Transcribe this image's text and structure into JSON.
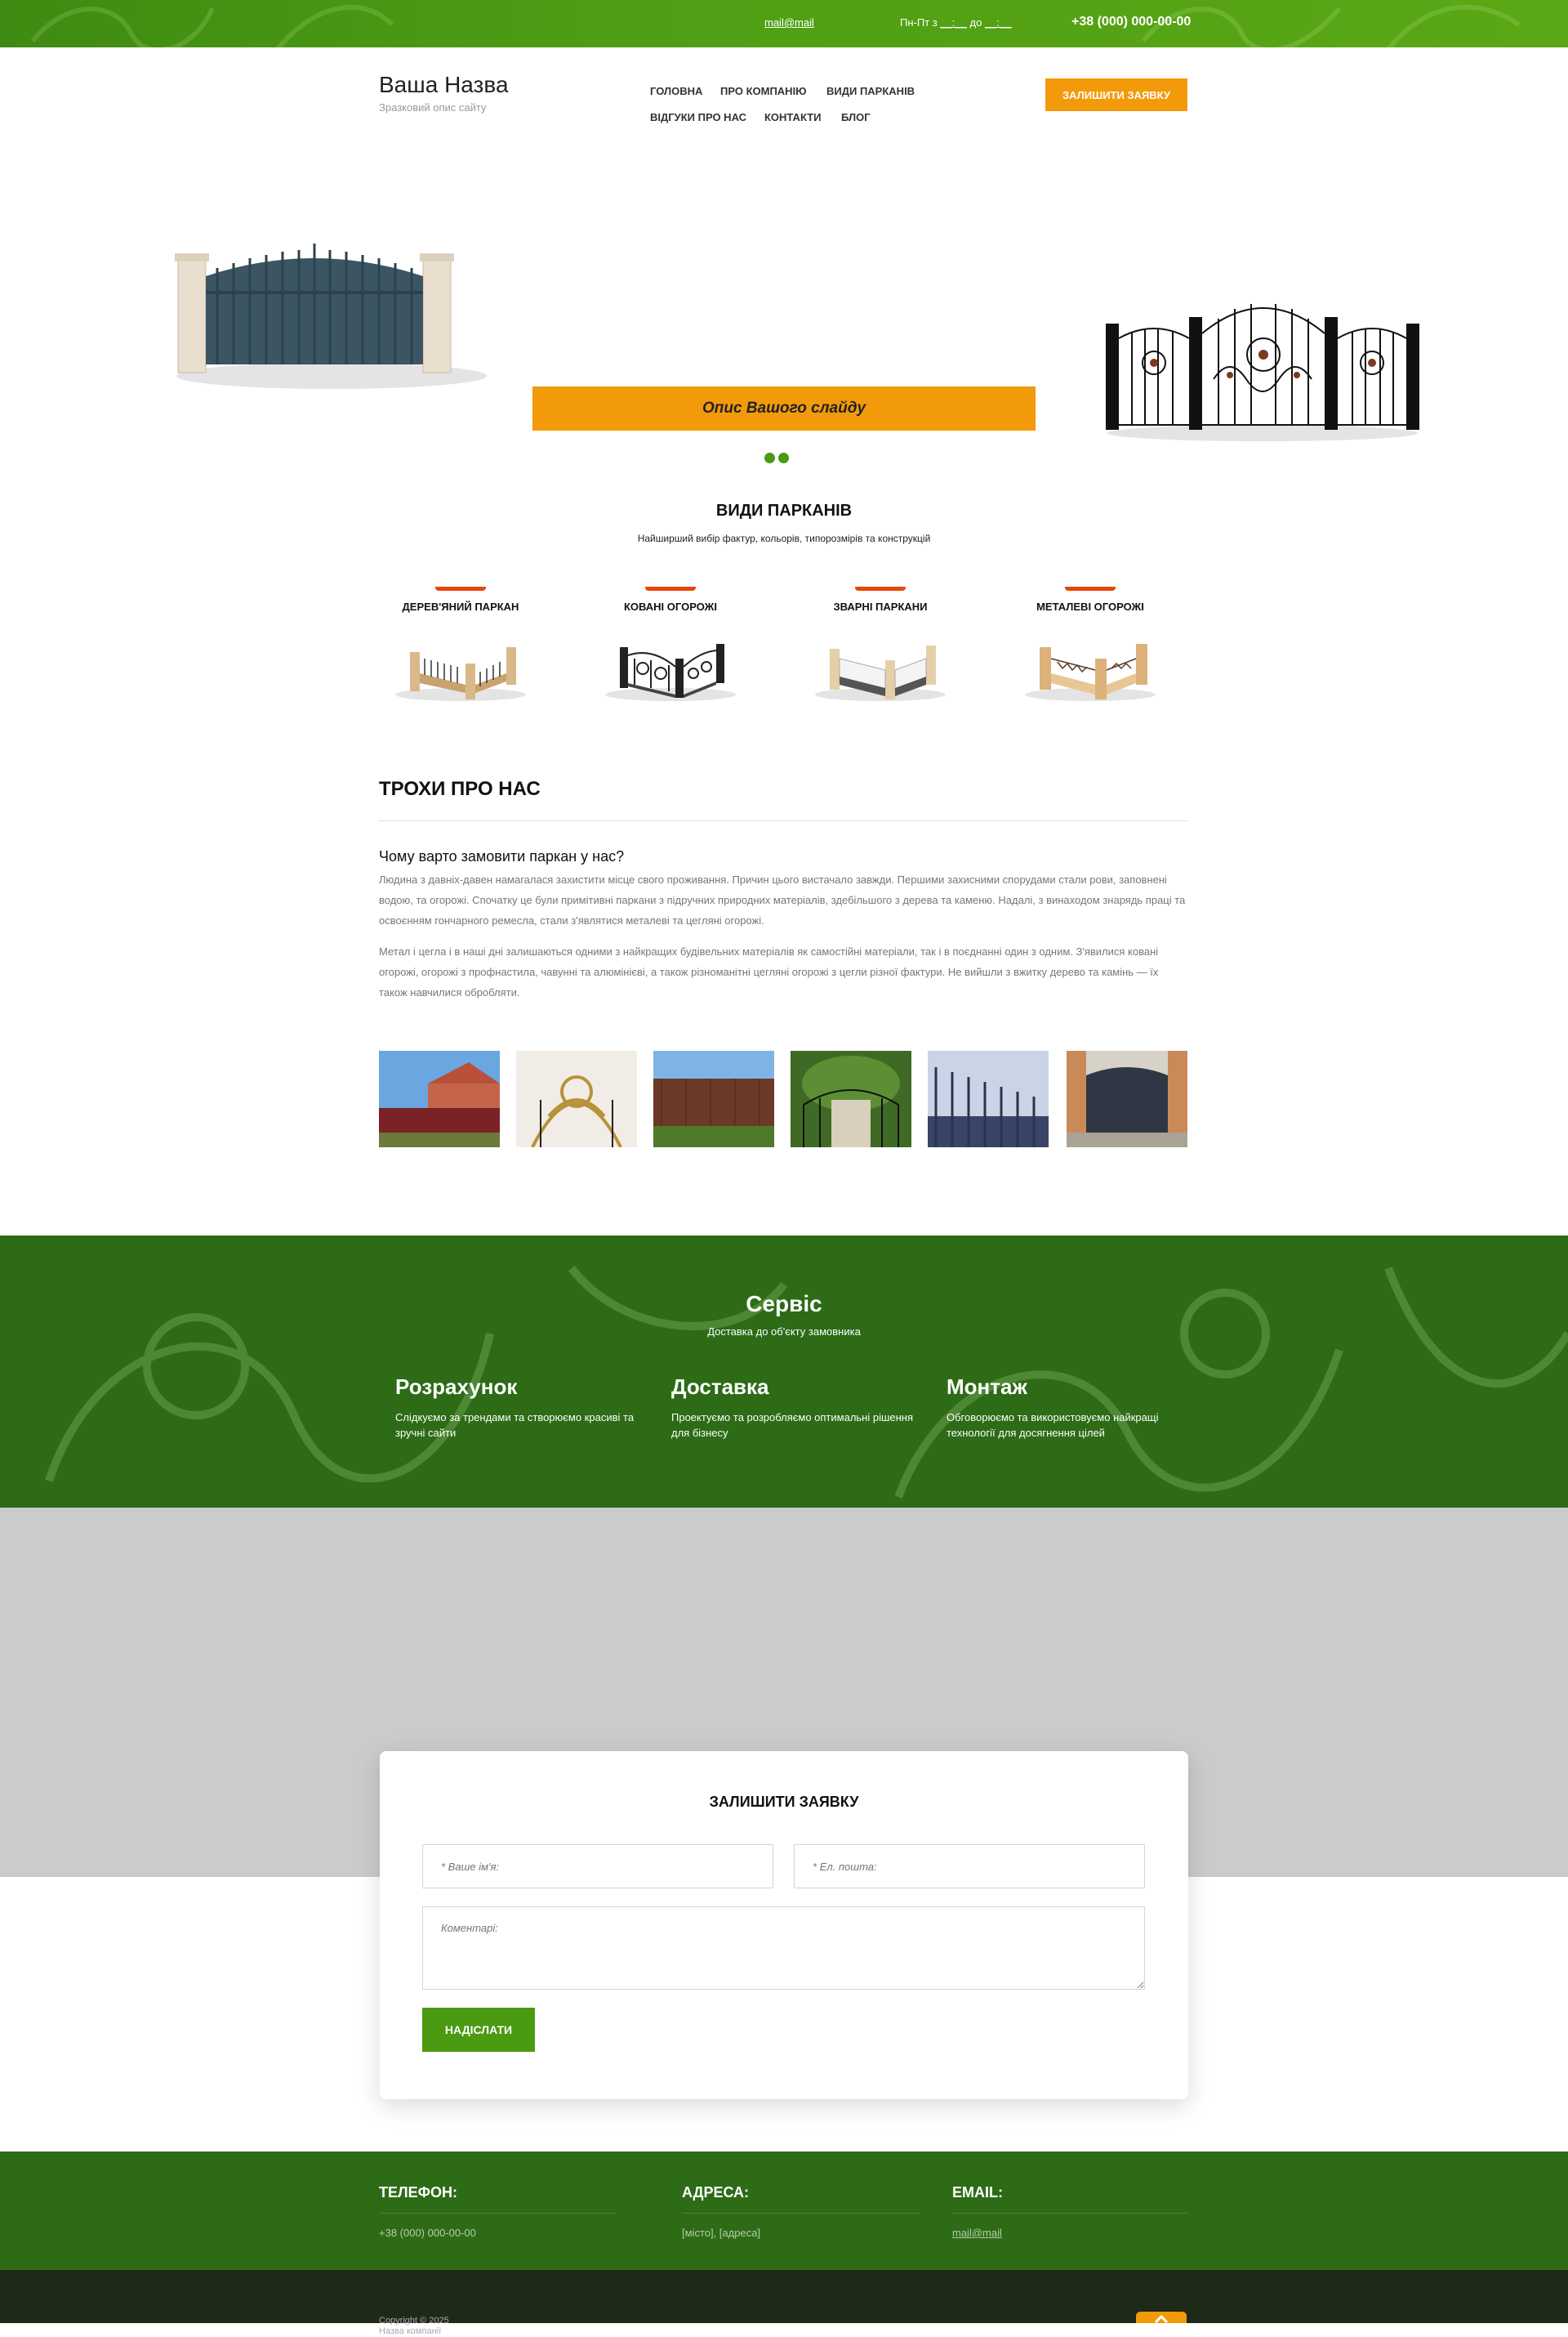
{
  "topbar": {
    "email": "mail@mail",
    "hours": "Пн-Пт з __:__ до __:__",
    "phone": "+38 (000) 000-00-00"
  },
  "header": {
    "logo_title": "Ваша Назва",
    "logo_subtitle": "Зразковий опис сайту",
    "nav": [
      "ГОЛОВНА",
      "ПРО КОМПАНІЮ",
      "ВИДИ ПАРКАНІВ",
      "ВІДГУКИ ПРО НАС",
      "КОНТАКТИ",
      "БЛОГ"
    ],
    "cta_label": "ЗАЛИШИТИ ЗАЯВКУ"
  },
  "slider": {
    "caption": "Опис Вашого слайду",
    "slide_count": 2,
    "active_slide": 1
  },
  "fence_types": {
    "title": "ВИДИ ПАРКАНІВ",
    "subtitle": "Найширший вибір фактур, кольорів, типорозмірів та конструкцій",
    "items": [
      "ДЕРЕВ'ЯНИЙ ПАРКАН",
      "КОВАНІ ОГОРОЖІ",
      "ЗВАРНІ ПАРКАНИ",
      "МЕТАЛЕВІ ОГОРОЖІ"
    ]
  },
  "about": {
    "title": "ТРОХИ ПРО НАС",
    "question": "Чому варто замовити паркан у нас?",
    "paragraphs": [
      "Людина з давніх-давен намагалася захистити місце свого проживання. Причин цього вистачало завжди. Першими захисними спорудами стали рови, заповнені водою, та огорожі. Спочатку це були примітивні паркани з підручних природних матеріалів, здебільшого з дерева та каменю. Надалі, з винаходом знарядь праці та освоєнням гончарного ремесла, стали з'являтися металеві та цегляні огорожі.",
      "Метал і цегла і в наші дні залишаються одними з найкращих будівельних матеріалів як самостійні матеріали, так і в поєднанні один з одним. З'явилися ковані огорожі, огорожі з профнастила, чавунні та алюмінієві, а також різноманітні цегляні огорожі з цегли різної фактури. Не вийшли з вжитку дерево та камінь — їх також навчилися обробляти."
    ]
  },
  "service": {
    "title": "Сервіс",
    "subtitle": "Доставка до об'єкту замовника",
    "columns": [
      {
        "title": "Розрахунок",
        "text": "Слідкуємо за трендами та створюємо красиві та зручні сайти"
      },
      {
        "title": "Доставка",
        "text": "Проектуємо та розробляємо оптимальні рішення для бізнесу"
      },
      {
        "title": "Монтаж",
        "text": "Обговорюємо та використовуємо найкращі технології для досягнення цілей"
      }
    ]
  },
  "form": {
    "title": "ЗАЛИШИТИ ЗАЯВКУ",
    "name_placeholder": "* Ваше ім'я:",
    "email_placeholder": "* Ел. пошта:",
    "comment_placeholder": "Коментарі:",
    "submit_label": "НАДІСЛАТИ"
  },
  "footer": {
    "phone_label": "ТЕЛЕФОН:",
    "phone_value": "+38 (000) 000-00-00",
    "address_label": "АДРЕСА:",
    "address_value": "[місто], [адреса]",
    "email_label": "EMAIL:",
    "email_value": "mail@mail",
    "copyright_line1": "Copyright © 2025",
    "copyright_line2": "Назва компанії"
  },
  "colors": {
    "brand_green": "#4a9a12",
    "dark_green": "#2d6b17",
    "accent_orange": "#f39a0b"
  }
}
